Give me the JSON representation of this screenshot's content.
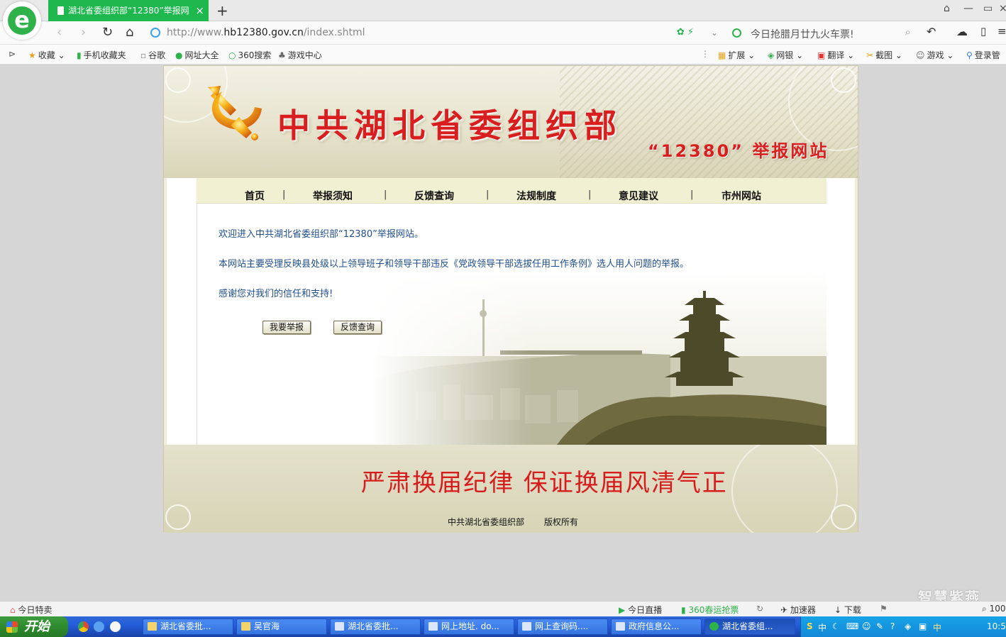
{
  "browser": {
    "tab_title": "湖北省委组织部“12380”举报网",
    "tab_close": "×",
    "new_tab": "+",
    "url_prefix": "http://www.",
    "url_host": "hb12380.gov.cn",
    "url_path": "/index.shtml",
    "search_text": "今日抢腊月廿九火车票!",
    "favorites": [
      "收藏",
      "手机收藏夹",
      "谷歌",
      "网址大全",
      "360搜索",
      "游戏中心"
    ],
    "extensions": [
      "扩展",
      "网银",
      "翻译",
      "截图",
      "游戏",
      "登录管"
    ]
  },
  "site": {
    "title": "中共湖北省委组织部",
    "subtitle": "“12380” 举报网站",
    "menu": [
      "首页",
      "举报须知",
      "反馈查询",
      "法规制度",
      "意见建议",
      "市州网站"
    ],
    "menu_separator": "|",
    "intro_1": "欢迎进入中共湖北省委组织部“12380”举报网站。",
    "intro_2": "本网站主要受理反映县处级以上领导班子和领导干部违反《党政领导干部选拔任用工作条例》选人用人问题的举报。",
    "intro_3": "感谢您对我们的信任和支持!",
    "report_button": "我要举报",
    "feedback_button": "反馈查询",
    "slogan": "严肃换届纪律  保证换届风清气正",
    "footer_org": "中共湖北省委组织部",
    "footer_rights": "版权所有"
  },
  "statusbar": {
    "left": "今日特卖",
    "live": "今日直播",
    "tickets": "360春运抢票",
    "accelerator": "加速器",
    "download": "下载",
    "zoom": "100"
  },
  "watermark": "智慧紫燕",
  "taskbar": {
    "start": "开始",
    "tasks": [
      "湖北省委批...",
      "吴官海",
      "湖北省委批...",
      "网上地址. do...",
      "网上查询码....",
      "政府信息公...",
      "湖北省委组..."
    ],
    "ime": "中",
    "clock": "10:5"
  },
  "colors": {
    "accent_green": "#1fb84f",
    "site_red": "#d81e1e",
    "intro_blue": "#1f4e8c",
    "banner_beige": "#e6e2cb",
    "taskbar_blue": "#245edb"
  }
}
